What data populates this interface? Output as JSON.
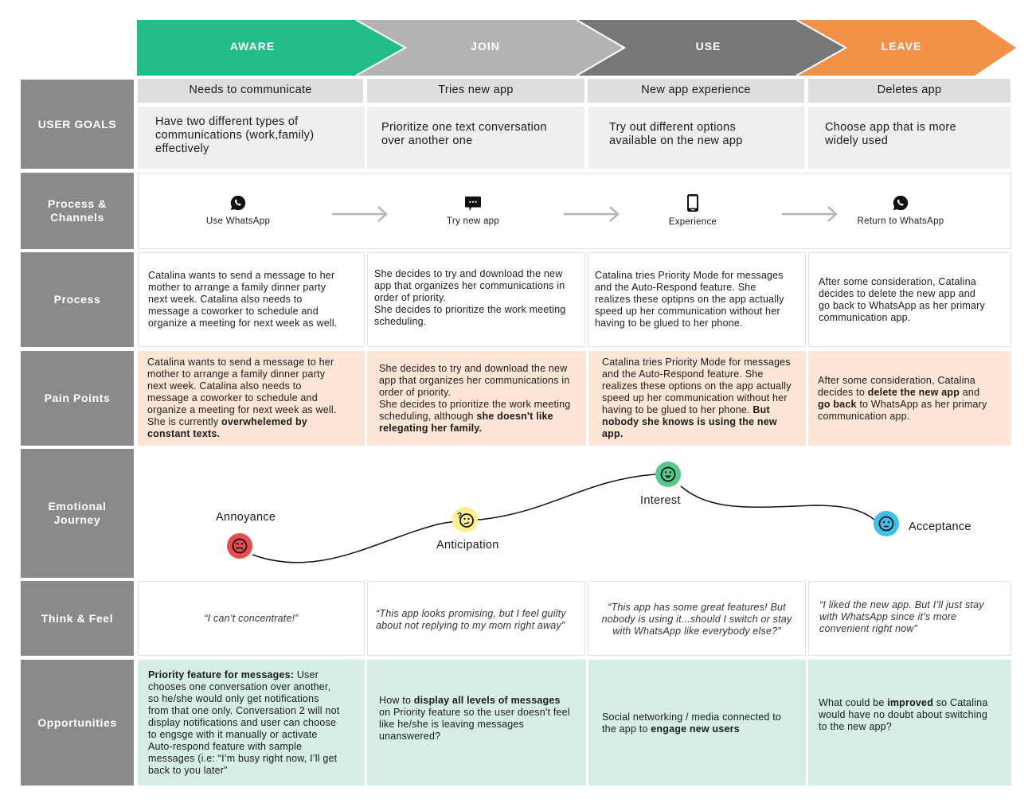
{
  "stages": [
    {
      "label": "AWARE",
      "color": "#25bd87"
    },
    {
      "label": "JOIN",
      "color": "#b3b3b3"
    },
    {
      "label": "USE",
      "color": "#777777"
    },
    {
      "label": "LEAVE",
      "color": "#f39149"
    }
  ],
  "row_labels": {
    "user_goals": "USER GOALS",
    "process_channels_1": "Process &",
    "process_channels_2": "Channels",
    "process": "Process",
    "pain_points": "Pain Points",
    "emotional_journey_1": "Emotional",
    "emotional_journey_2": "Journey",
    "think_feel": "Think & Feel",
    "opportunities": "Opportunities"
  },
  "user_goals": [
    {
      "title": "Needs to communicate",
      "lines": [
        "Have two different types of",
        "communications (work,family)",
        "effectively"
      ]
    },
    {
      "title": "Tries new app",
      "lines": [
        "Prioritize one text conversation",
        "over another one"
      ]
    },
    {
      "title": "New app experience",
      "lines": [
        "Try out different options",
        "available on the new app"
      ]
    },
    {
      "title": "Deletes app",
      "lines": [
        "Choose app that is more",
        "widely used"
      ]
    }
  ],
  "channels": [
    {
      "label": "Use WhatsApp",
      "icon": "whatsapp-icon"
    },
    {
      "label": "Try new app",
      "icon": "chat-bubble-icon"
    },
    {
      "label": "Experience",
      "icon": "smartphone-icon"
    },
    {
      "label": "Return to WhatsApp",
      "icon": "whatsapp-icon"
    }
  ],
  "process": [
    [
      "Catalina wants to send a message to her",
      "mother to arrange a family dinner party",
      "next week. Catalina also needs to",
      "message a coworker to schedule and",
      "organize a meeting for next week as well."
    ],
    [
      "She decides to try and download the new",
      "app that organizes her communications in",
      "order of priority.",
      "She decides to prioritize the work meeting",
      "scheduling."
    ],
    [
      "Catalina tries Priority Mode for messages",
      "and the Auto-Respond feature. She",
      "realizes these optipns on the app actually",
      "speed up her communication without her",
      "having to be glued to her phone."
    ],
    [
      "After some consideration, Catalina",
      "decides to delete the new app and",
      "go back to WhatsApp as her primary",
      "communication app."
    ]
  ],
  "pain_points": [
    [
      [
        {
          "t": "Catalina wants to send a message to her"
        }
      ],
      [
        {
          "t": "mother to arrange a family dinner party"
        }
      ],
      [
        {
          "t": "next week. Catalina also needs to"
        }
      ],
      [
        {
          "t": "message a coworker to schedule and"
        }
      ],
      [
        {
          "t": "organize a meeting for next week as well."
        }
      ],
      [
        {
          "t": "She is currently "
        },
        {
          "t": "overwhelemed by",
          "b": true
        }
      ],
      [
        {
          "t": "constant texts.",
          "b": true
        }
      ]
    ],
    [
      [
        {
          "t": "She decides to try and download the new"
        }
      ],
      [
        {
          "t": "app that organizes her communications in"
        }
      ],
      [
        {
          "t": "order of priority."
        }
      ],
      [
        {
          "t": "She decides to prioritize the work meeting"
        }
      ],
      [
        {
          "t": "scheduling, although "
        },
        {
          "t": "she doesn't like",
          "b": true
        }
      ],
      [
        {
          "t": "relegating her family.",
          "b": true
        }
      ]
    ],
    [
      [
        {
          "t": "Catalina tries Priority Mode for messages"
        }
      ],
      [
        {
          "t": "and the Auto-Respond feature. She"
        }
      ],
      [
        {
          "t": "realizes these options on the app actually"
        }
      ],
      [
        {
          "t": "speed up her communication without her"
        }
      ],
      [
        {
          "t": "having to be glued to her phone. "
        },
        {
          "t": "But",
          "b": true
        }
      ],
      [
        {
          "t": "nobody she knows is using the new",
          "b": true
        }
      ],
      [
        {
          "t": "app.",
          "b": true
        }
      ]
    ],
    [
      [
        {
          "t": "After some consideration, Catalina"
        }
      ],
      [
        {
          "t": "decides to "
        },
        {
          "t": "delete the new app",
          "b": true
        },
        {
          "t": " and"
        }
      ],
      [
        {
          "t": "go back",
          "b": true
        },
        {
          "t": " to WhatsApp as her primary"
        }
      ],
      [
        {
          "t": "communication app."
        }
      ]
    ]
  ],
  "emotions": [
    {
      "label": "Annoyance",
      "color": "#e84c4e",
      "face": "angry-face-icon",
      "level": 0.15
    },
    {
      "label": "Anticipation",
      "color": "#fbf08c",
      "face": "thinking-face-icon",
      "level": 0.45
    },
    {
      "label": "Interest",
      "color": "#55c98b",
      "face": "smiling-face-icon",
      "level": 0.95
    },
    {
      "label": "Acceptance",
      "color": "#41bfe6",
      "face": "neutral-face-icon",
      "level": 0.55
    }
  ],
  "think_feel": [
    {
      "lines": [
        "“I can’t concentrate!”"
      ],
      "align": "center"
    },
    {
      "lines": [
        "“This app looks promising, but I feel guilty",
        "about not replying to my mom right away”"
      ],
      "align": "left"
    },
    {
      "lines": [
        "“This app has some great features! But",
        "nobody is using it...should I switch or stay",
        "with WhatsApp like everybody else?”"
      ],
      "align": "center"
    },
    {
      "lines": [
        "“I liked the new app. But I’ll just stay",
        "with WhatsApp since it’s more",
        "convenient right now”"
      ],
      "align": "left"
    }
  ],
  "opportunities": [
    [
      [
        {
          "t": "Priority feature for messages:",
          "b": true
        },
        {
          "t": " User"
        }
      ],
      [
        {
          "t": "chooses one conversation over another,"
        }
      ],
      [
        {
          "t": "so he/she would only get notifications"
        }
      ],
      [
        {
          "t": "from that one only. Conversation 2 will not"
        }
      ],
      [
        {
          "t": "display notifications and user can choose"
        }
      ],
      [
        {
          "t": "to engsge with it manually or activate"
        }
      ],
      [
        {
          "t": "Auto-respond feature with sample"
        }
      ],
      [
        {
          "t": "messages (i.e: “I’m busy right now, I’ll get"
        }
      ],
      [
        {
          "t": "back to you later”"
        }
      ]
    ],
    [
      [
        {
          "t": "How to "
        },
        {
          "t": "display all levels of messages",
          "b": true
        }
      ],
      [
        {
          "t": "on Priority feature so the user doesn't feel"
        }
      ],
      [
        {
          "t": "like he/she is leaving messages"
        }
      ],
      [
        {
          "t": "unanswered?"
        }
      ]
    ],
    [
      [
        {
          "t": "Social networking / media connected to"
        }
      ],
      [
        {
          "t": "the app to "
        },
        {
          "t": "engage new users",
          "b": true
        }
      ]
    ],
    [
      [
        {
          "t": "What could be "
        },
        {
          "t": "improved",
          "b": true
        },
        {
          "t": " so Catalina"
        }
      ],
      [
        {
          "t": "would have no doubt about switching"
        }
      ],
      [
        {
          "t": "to the new app?"
        }
      ]
    ]
  ]
}
